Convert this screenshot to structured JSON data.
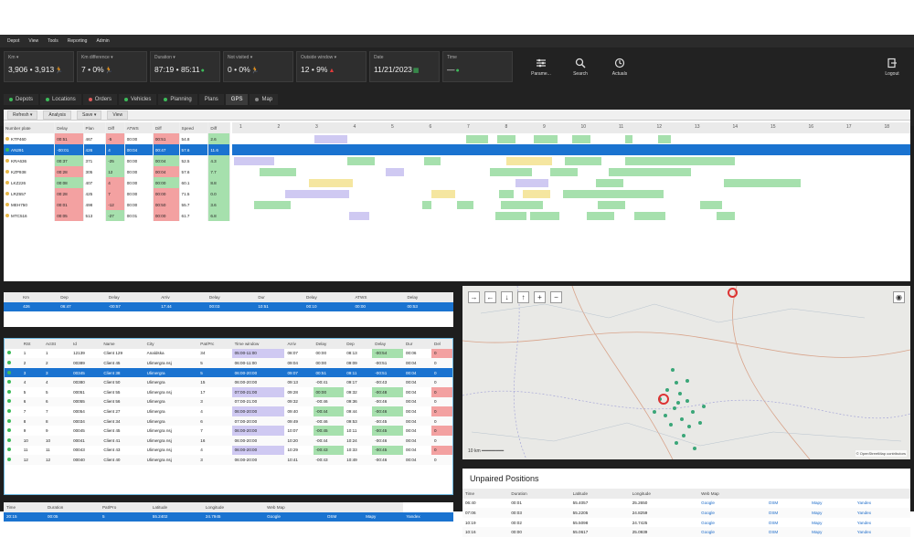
{
  "menu": [
    "Depot",
    "View",
    "Tools",
    "Reporting",
    "Admin"
  ],
  "kpis": [
    {
      "label": "Km ▾",
      "value": "3,906 • 3,913",
      "icon": "person-run-icon",
      "ic": "🏃",
      "status": "red"
    },
    {
      "label": "Km difference ▾",
      "value": "7 • 0%",
      "icon": "person-run-icon",
      "ic": "🏃",
      "status": "red"
    },
    {
      "label": "Duration ▾",
      "value": "87:19 • 85:11",
      "icon": "check-circle-icon",
      "ic": "●",
      "status": "green"
    },
    {
      "label": "Not visited ▾",
      "value": "0 • 0%",
      "icon": "person-run-icon",
      "ic": "🏃",
      "status": "green"
    },
    {
      "label": "Outside window ▾",
      "value": "12 • 9%",
      "icon": "warning-icon",
      "ic": "▲",
      "status": "red"
    },
    {
      "label": "Date",
      "value": "11/21/2023",
      "icon": "calendar-icon",
      "ic": "▦",
      "status": "green"
    },
    {
      "label": "Time",
      "value": "—",
      "icon": "check-circle-icon",
      "ic": "●",
      "status": "green"
    }
  ],
  "toolbar": {
    "params": "Parame...",
    "search": "Search",
    "refresh": "Actuals",
    "logout": "Logout"
  },
  "tabs": [
    {
      "label": "Depots",
      "color": "#3dbb5a"
    },
    {
      "label": "Locations",
      "color": "#3dbb5a"
    },
    {
      "label": "Orders",
      "color": "#e05b5b"
    },
    {
      "label": "Vehicles",
      "color": "#3dbb5a"
    },
    {
      "label": "Planning",
      "color": "#3dbb5a"
    },
    {
      "label": "Plans",
      "color": ""
    },
    {
      "label": "GPS",
      "color": ""
    },
    {
      "label": "Map",
      "color": "#888888"
    }
  ],
  "gantt_toolbar": [
    "Refresh ▾",
    "Analysis",
    "Save ▾",
    "View"
  ],
  "gantt": {
    "headers": [
      "Number plate",
      "Delay",
      "Plan",
      "Diff",
      "ATWS",
      "Diff",
      "Speed",
      "Diff"
    ],
    "hours": [
      "1",
      "2",
      "3",
      "4",
      "5",
      "6",
      "7",
      "8",
      "9",
      "10",
      "11",
      "12",
      "13",
      "14",
      "15",
      "16",
      "17",
      "18"
    ],
    "rows": [
      {
        "plate": "KTP460",
        "c": [
          "00:51",
          "467",
          "-5",
          "00:00",
          "00:51",
          "54.8",
          "2.6"
        ],
        "dot": "#e6b84a"
      },
      {
        "plate": "AN291",
        "c": [
          "-00:01",
          "426",
          "4",
          "00:04",
          "00:47",
          "57.6",
          "11.6"
        ],
        "dot": "#3dbb5a",
        "sel": true
      },
      {
        "plate": "KRA636",
        "c": [
          "00:37",
          "371",
          "-25",
          "00:00",
          "00:04",
          "52.5",
          "4.3"
        ],
        "dot": "#e6b84a"
      },
      {
        "plate": "KZP938",
        "c": [
          "00:28",
          "305",
          "12",
          "00:00",
          "00:04",
          "57.6",
          "7.7"
        ],
        "dot": "#e6b84a"
      },
      {
        "plate": "LKZ226",
        "c": [
          "00:08",
          "407",
          "4",
          "00:00",
          "00:00",
          "60.1",
          "8.8"
        ],
        "dot": "#e6b84a"
      },
      {
        "plate": "LRZ657",
        "c": [
          "00:28",
          "425",
          "7",
          "00:00",
          "00:00",
          "71.5",
          "0.0"
        ],
        "dot": "#e6b84a"
      },
      {
        "plate": "MEH750",
        "c": [
          "00:01",
          "498",
          "-12",
          "00:00",
          "00:50",
          "55.7",
          "3.6"
        ],
        "dot": "#e6b84a"
      },
      {
        "plate": "MTC516",
        "c": [
          "00:05",
          "513",
          "-27",
          "00:01",
          "00:00",
          "61.7",
          "6.8"
        ],
        "dot": "#e6b84a"
      }
    ]
  },
  "vehicle_summary": {
    "headers": [
      "Km",
      "Dep",
      "Delay",
      "Arriv",
      "Delay",
      "Dur",
      "Delay",
      "ATWS",
      "Delay"
    ],
    "row": [
      "426",
      "06:47",
      "-00:57",
      "17:44",
      "00:03",
      "10:51",
      "00:10",
      "00:00",
      "00:53"
    ]
  },
  "orders": {
    "headers": [
      "RSt",
      "ActSt",
      "Id",
      "Name",
      "City",
      "Pat/Prc",
      "Time window",
      "Arriv",
      "Delay",
      "Dep",
      "Delay",
      "Dur",
      "Del"
    ],
    "rows": [
      [
        "1",
        "1",
        "12139",
        "Client 129",
        "Analdska",
        "34",
        "05:00-11:00",
        "08:07",
        "00:00",
        "08:13",
        "-00:54",
        "00:06",
        "0"
      ],
      [
        "2",
        "2",
        "00389",
        "Client 45",
        "Ulimergra nsj",
        "5",
        "06:00-11:00",
        "09:04",
        "00:00",
        "09:09",
        "-00:51",
        "00:04",
        "0"
      ],
      [
        "3",
        "3",
        "00345",
        "Client 38",
        "Ulimergra",
        "5",
        "06:00-20:00",
        "09:07",
        "00:51",
        "09:11",
        "-00:51",
        "00:04",
        "0"
      ],
      [
        "4",
        "4",
        "00380",
        "Client 50",
        "Ulimergra",
        "15",
        "06:00-20:00",
        "09:13",
        "-00:41",
        "09:17",
        "-00:43",
        "00:04",
        "0"
      ],
      [
        "5",
        "5",
        "00051",
        "Client 55",
        "Ulimergra nsj",
        "17",
        "07:00-21:00",
        "09:28",
        "00:00",
        "09:32",
        "-00:48",
        "00:04",
        "0"
      ],
      [
        "6",
        "6",
        "00055",
        "Client 56",
        "Ulimergra",
        "3",
        "07:00-21:00",
        "09:32",
        "-00:46",
        "09:36",
        "-00:46",
        "00:04",
        "0"
      ],
      [
        "7",
        "7",
        "00054",
        "Client 27",
        "Ulimergra",
        "4",
        "06:00-20:00",
        "09:40",
        "-00:44",
        "09:44",
        "-00:46",
        "00:04",
        "0"
      ],
      [
        "8",
        "8",
        "00034",
        "Client 34",
        "Ulimergra",
        "6",
        "07:00-20:00",
        "09:49",
        "-00:46",
        "09:53",
        "-00:45",
        "00:04",
        "0"
      ],
      [
        "9",
        "9",
        "00045",
        "Client 45",
        "Ulimergra nsj",
        "7",
        "06:00-20:00",
        "10:07",
        "-00:45",
        "10:11",
        "-00:45",
        "00:04",
        "0"
      ],
      [
        "10",
        "10",
        "00041",
        "Client 41",
        "Ulimergra nsj",
        "16",
        "06:00-20:00",
        "10:20",
        "-00:44",
        "10:24",
        "-00:46",
        "00:04",
        "0"
      ],
      [
        "11",
        "11",
        "00043",
        "Client 43",
        "Ulimergra nsj",
        "4",
        "06:00-20:00",
        "10:29",
        "-00:43",
        "10:33",
        "-00:45",
        "00:04",
        "0"
      ],
      [
        "12",
        "12",
        "00040",
        "Client 40",
        "Ulimergra nsj",
        "3",
        "06:00-20:00",
        "10:41",
        "-00:43",
        "10:49",
        "-00:46",
        "00:04",
        "0"
      ]
    ]
  },
  "gps": {
    "headers": [
      "Time",
      "Duration",
      "Pat/Pro",
      "Latitude",
      "Longitude",
      "Web Map",
      "",
      ""
    ],
    "row": [
      "20:15",
      "00:05",
      "5",
      "55.2402",
      "24.7945",
      "Google",
      "OSM",
      "Mapy",
      "Yandex"
    ]
  },
  "map": {
    "scale": "10 km",
    "attribution": "© OpenStreetMap contributors",
    "controls": [
      "→",
      "←",
      "↓",
      "↑",
      "+",
      "−"
    ]
  },
  "unpaired": {
    "title": "Unpaired Positions",
    "headers": [
      "Time",
      "Duration",
      "Latitude",
      "Longitude",
      "Web Map",
      "",
      "",
      ""
    ],
    "rows": [
      [
        "06:40",
        "00:01",
        "55.4057",
        "25.2650",
        "Google",
        "OSM",
        "Mapy",
        "Yandex"
      ],
      [
        "07:06",
        "00:03",
        "55.2205",
        "24.8259",
        "Google",
        "OSM",
        "Mapy",
        "Yandex"
      ],
      [
        "10:19",
        "00:02",
        "55.5098",
        "24.7425",
        "Google",
        "OSM",
        "Mapy",
        "Yandex"
      ],
      [
        "10:16",
        "00:00",
        "55.0617",
        "25.0939",
        "Google",
        "OSM",
        "Mapy",
        "Yandex"
      ]
    ]
  },
  "colors": {
    "accent": "#1a73d0",
    "green": "#3dbb5a",
    "red": "#e03b3b",
    "dark": "#1e1e1e"
  }
}
